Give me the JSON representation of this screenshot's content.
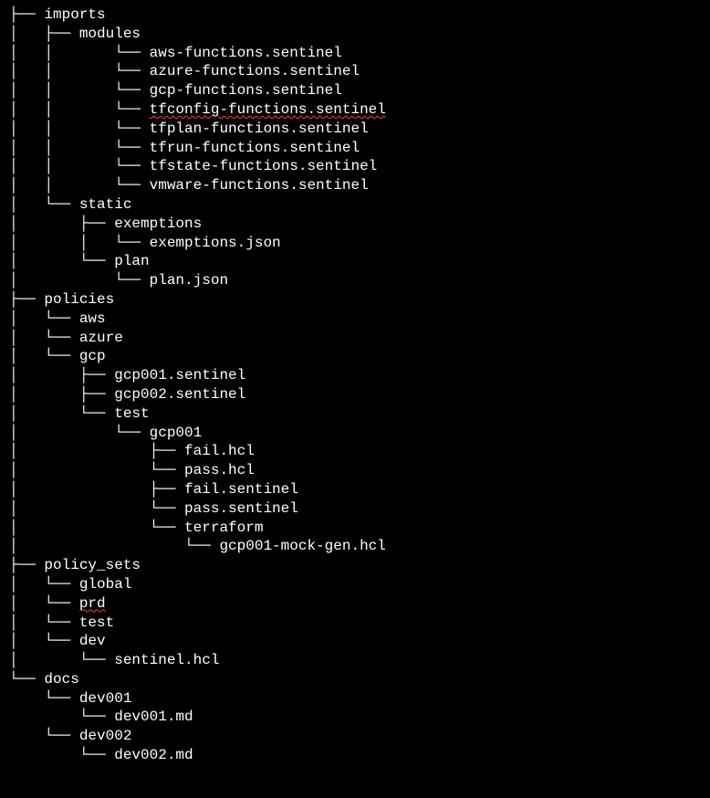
{
  "tree": {
    "imports": {
      "label": "imports",
      "modules": {
        "label": "modules",
        "files": {
          "aws": "aws-functions.sentinel",
          "azure": "azure-functions.sentinel",
          "gcp": "gcp-functions.sentinel",
          "tfconfig": "tfconfig-functions.sentinel",
          "tfplan": "tfplan-functions.sentinel",
          "tfrun": "tfrun-functions.sentinel",
          "tfstate": "tfstate-functions.sentinel",
          "vmware": "vmware-functions.sentinel"
        }
      },
      "static": {
        "label": "static",
        "exemptions": {
          "label": "exemptions",
          "file": "exemptions.json"
        },
        "plan": {
          "label": "plan",
          "file": "plan.json"
        }
      }
    },
    "policies": {
      "label": "policies",
      "aws": "aws",
      "azure": "azure",
      "gcp": {
        "label": "gcp",
        "gcp001": "gcp001.sentinel",
        "gcp002": "gcp002.sentinel",
        "test": {
          "label": "test",
          "gcp001dir": {
            "label": "gcp001",
            "fail_hcl": "fail.hcl",
            "pass_hcl": "pass.hcl",
            "fail_sentinel": "fail.sentinel",
            "pass_sentinel": "pass.sentinel",
            "terraform": {
              "label": "terraform",
              "mockgen": "gcp001-mock-gen.hcl"
            }
          }
        }
      }
    },
    "policy_sets": {
      "label": "policy_sets",
      "global": "global",
      "prd": "prd",
      "test": "test",
      "dev": {
        "label": "dev",
        "file": "sentinel.hcl"
      }
    },
    "docs": {
      "label": "docs",
      "dev001": {
        "label": "dev001",
        "file": "dev001.md"
      },
      "dev002": {
        "label": "dev002",
        "file": "dev002.md"
      }
    }
  }
}
